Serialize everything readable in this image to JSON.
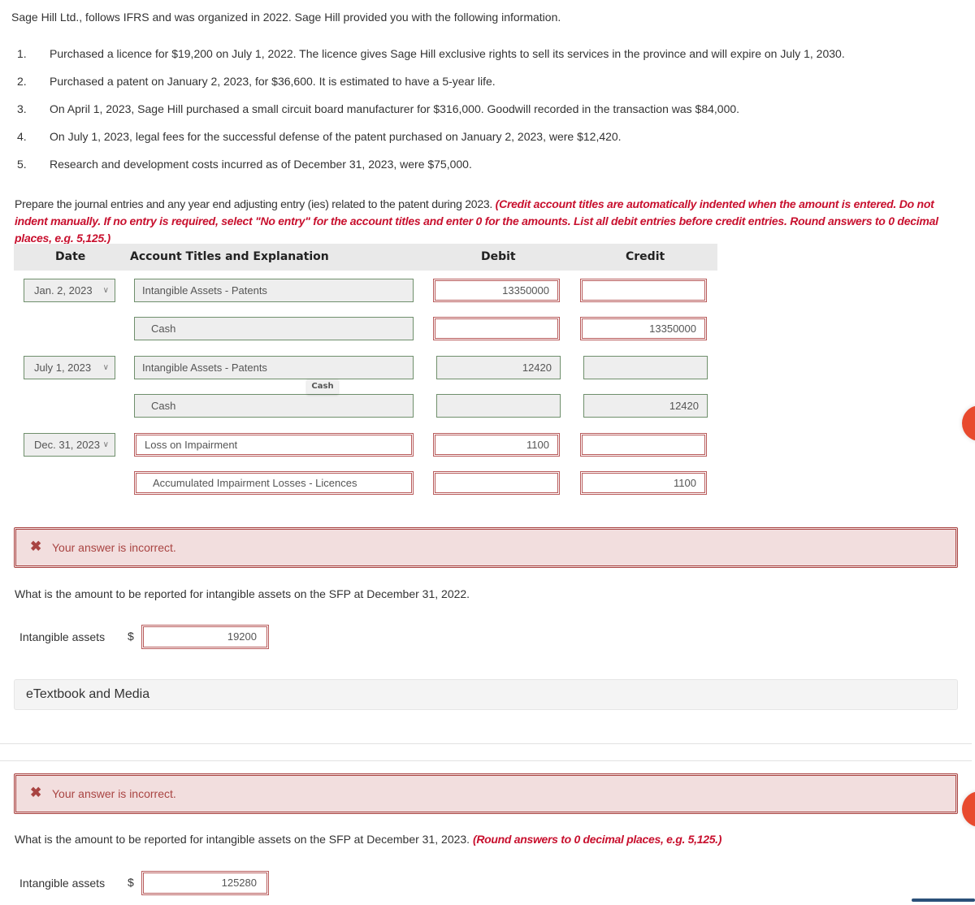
{
  "intro": "Sage Hill Ltd., follows IFRS and was organized in 2022. Sage Hill provided you with the following information.",
  "facts": [
    {
      "num": "1.",
      "text": "Purchased a licence for $19,200 on July 1, 2022. The licence gives Sage Hill exclusive rights to sell its services in the province and will expire on July 1, 2030."
    },
    {
      "num": "2.",
      "text": "Purchased a patent on January 2, 2023, for $36,600. It is estimated to have a 5-year life."
    },
    {
      "num": "3.",
      "text": "On April 1, 2023, Sage Hill purchased a small circuit board manufacturer for $316,000. Goodwill recorded in the transaction was $84,000."
    },
    {
      "num": "4.",
      "text": "On July 1, 2023, legal fees for the successful defense of the patent purchased on January 2, 2023, were $12,420."
    },
    {
      "num": "5.",
      "text": "Research and development costs incurred as of December 31, 2023, were $75,000."
    }
  ],
  "instructions": {
    "text": "Prepare the journal entries and any year end adjusting entry (ies) related to the patent during 2023. ",
    "note": "(Credit account titles are automatically indented when the amount is entered. Do not indent manually. If no entry is required, select \"No entry\" for the account titles and enter 0 for the amounts. List all debit entries before credit entries. Round answers to 0 decimal places, e.g. 5,125.)"
  },
  "journal": {
    "headers": {
      "date": "Date",
      "account": "Account Titles and Explanation",
      "debit": "Debit",
      "credit": "Credit"
    },
    "entries": [
      {
        "date": "Jan. 2, 2023",
        "lines": [
          {
            "account": "Intangible Assets - Patents",
            "debit": "13350000",
            "credit": ""
          },
          {
            "account": "Cash",
            "debit": "",
            "credit": "13350000"
          }
        ]
      },
      {
        "date": "July 1, 2023",
        "lines": [
          {
            "account": "Intangible Assets - Patents",
            "debit": "12420",
            "credit": ""
          },
          {
            "account": "Cash",
            "debit": "",
            "credit": "12420"
          }
        ]
      },
      {
        "date": "Dec. 31, 2023",
        "lines": [
          {
            "account": "Loss on Impairment",
            "debit": "1100",
            "credit": ""
          },
          {
            "account": "Accumulated Impairment Losses - Licences",
            "debit": "",
            "credit": "1100"
          }
        ]
      }
    ],
    "tooltip": "Cash"
  },
  "part2": {
    "feedback": "Your answer is incorrect.",
    "question": "What is the amount to be reported for intangible assets on the SFP at December 31, 2022.",
    "label": "Intangible assets",
    "currency": "$",
    "value": "19200"
  },
  "etextbook": "eTextbook and Media",
  "part3": {
    "feedback": "Your answer is incorrect.",
    "question": "What is the amount to be reported for intangible assets on the SFP at December 31, 2023. ",
    "note": "(Round answers to 0 decimal places, e.g. 5,125.)",
    "label": "Intangible assets",
    "currency": "$",
    "value": "125280"
  },
  "colors": {
    "error": "#a94442",
    "instruction_red": "#c8102e",
    "correct_border": "#6f8f6c",
    "side_button": "#e84a2e"
  }
}
